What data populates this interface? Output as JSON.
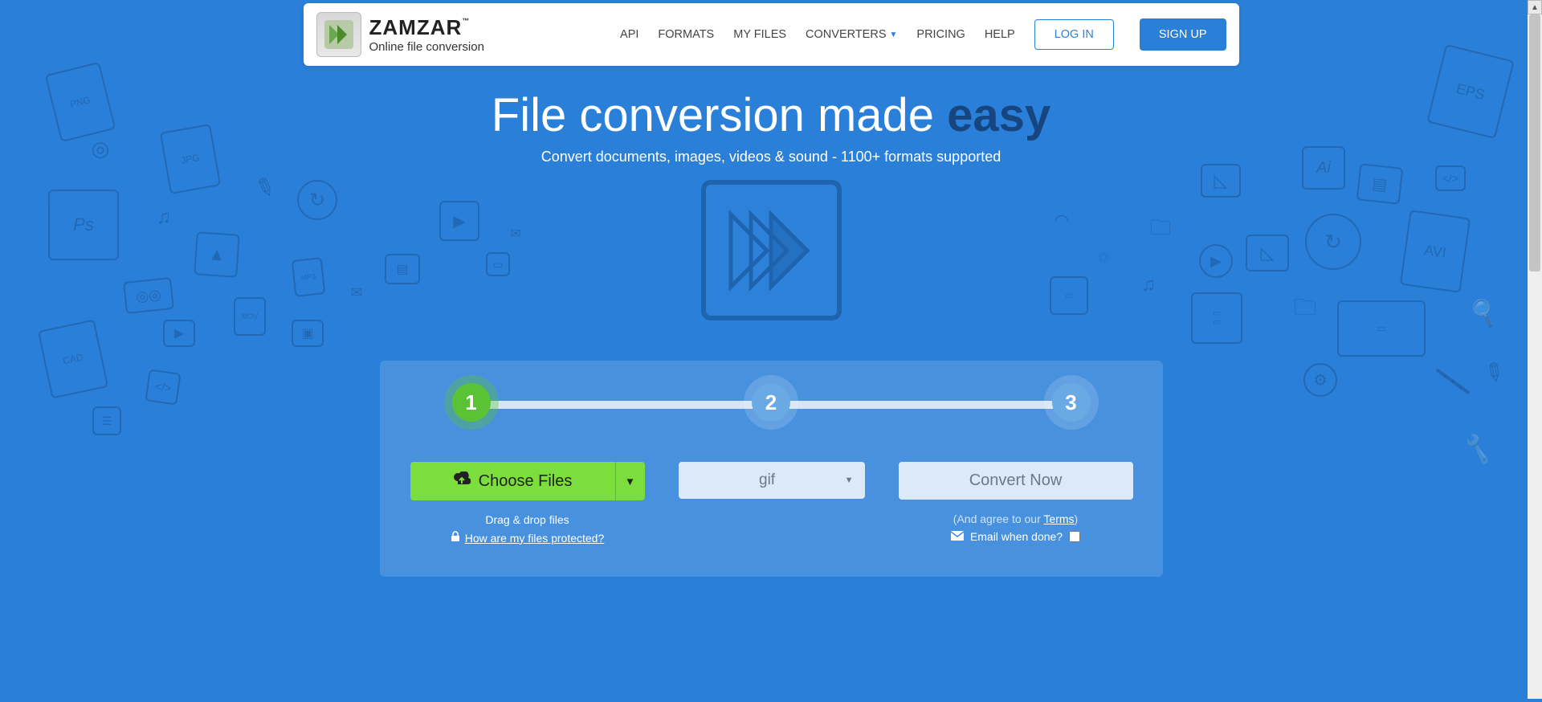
{
  "brand": {
    "name": "ZAMZAR",
    "tm": "™",
    "tagline": "Online file conversion"
  },
  "nav": {
    "api": "API",
    "formats": "FORMATS",
    "my_files": "MY FILES",
    "converters": "CONVERTERS",
    "pricing": "PRICING",
    "help": "HELP",
    "login": "LOG IN",
    "signup": "SIGN UP"
  },
  "hero": {
    "title_main": "File conversion made ",
    "title_accent": "easy",
    "subtitle": "Convert documents, images, videos & sound - 1100+ formats supported"
  },
  "steps": {
    "s1": "1",
    "s2": "2",
    "s3": "3"
  },
  "panel": {
    "choose_label": "Choose Files",
    "drag_hint": "Drag & drop files",
    "protect_question": "How are my files protected?",
    "format_selected": "gif",
    "convert_label": "Convert Now",
    "agree_prefix": "(And agree to our ",
    "agree_link": "Terms",
    "agree_suffix": ")",
    "email_label": "Email when done?"
  },
  "sketches": {
    "png": "PNG",
    "jpg": "JPG",
    "ps": "Ps",
    "cad": "CAD",
    "mov": "MOV",
    "mp3": "MP3",
    "ai": "Ai",
    "eps": "EPS",
    "avi": "AVI"
  }
}
